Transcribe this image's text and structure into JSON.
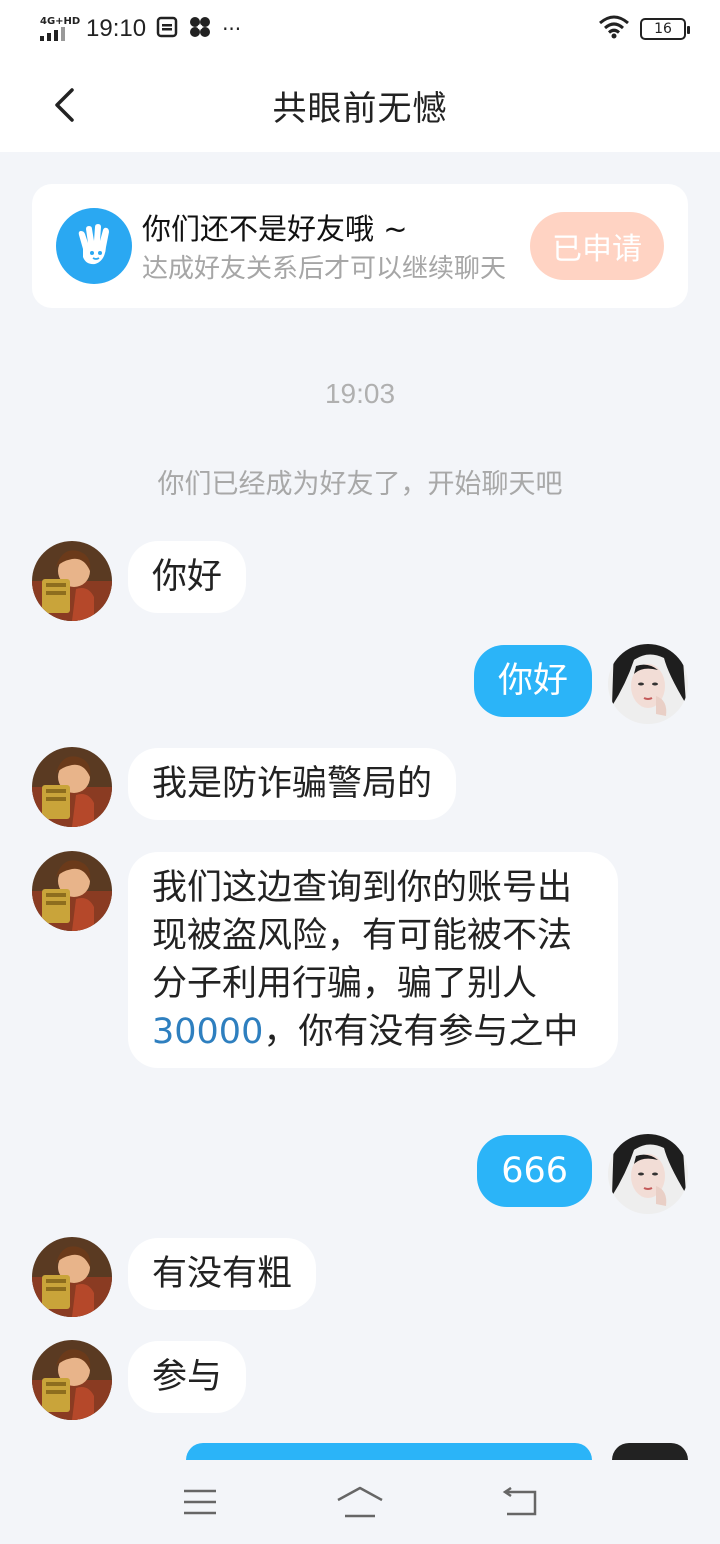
{
  "status_bar": {
    "network": "4G+HD",
    "time": "19:10",
    "battery": "16",
    "extra": "···"
  },
  "header": {
    "title": "共眼前无憾"
  },
  "notice": {
    "title": "你们还不是好友哦 ~",
    "subtitle": "达成好友关系后才可以继续聊天",
    "button_label": "已申请"
  },
  "chat": {
    "timestamp": "19:03",
    "system_message": "你们已经成为好友了，开始聊天吧",
    "messages": [
      {
        "from": "them",
        "text": "你好"
      },
      {
        "from": "me",
        "text": "你好"
      },
      {
        "from": "them",
        "text": "我是防诈骗警局的"
      },
      {
        "from": "them",
        "text_parts": [
          "我们这边查询到你的账号出现被盗风险，有可能被不法分子利用行骗，骗了别人",
          "30000",
          "，你有没有参与之中"
        ]
      },
      {
        "from": "me",
        "text": "666"
      },
      {
        "from": "them",
        "text": "有没有粗"
      },
      {
        "from": "them",
        "text": "参与"
      }
    ]
  },
  "colors": {
    "accent": "#2bb4f8",
    "notice_icon": "#2aa8f2",
    "applied_button": "#ffd3c3",
    "background": "#f3f5f9"
  },
  "icons": [
    "back-icon",
    "hand-icon",
    "wifi-icon",
    "battery-icon",
    "menu-icon",
    "home-icon",
    "return-icon"
  ]
}
